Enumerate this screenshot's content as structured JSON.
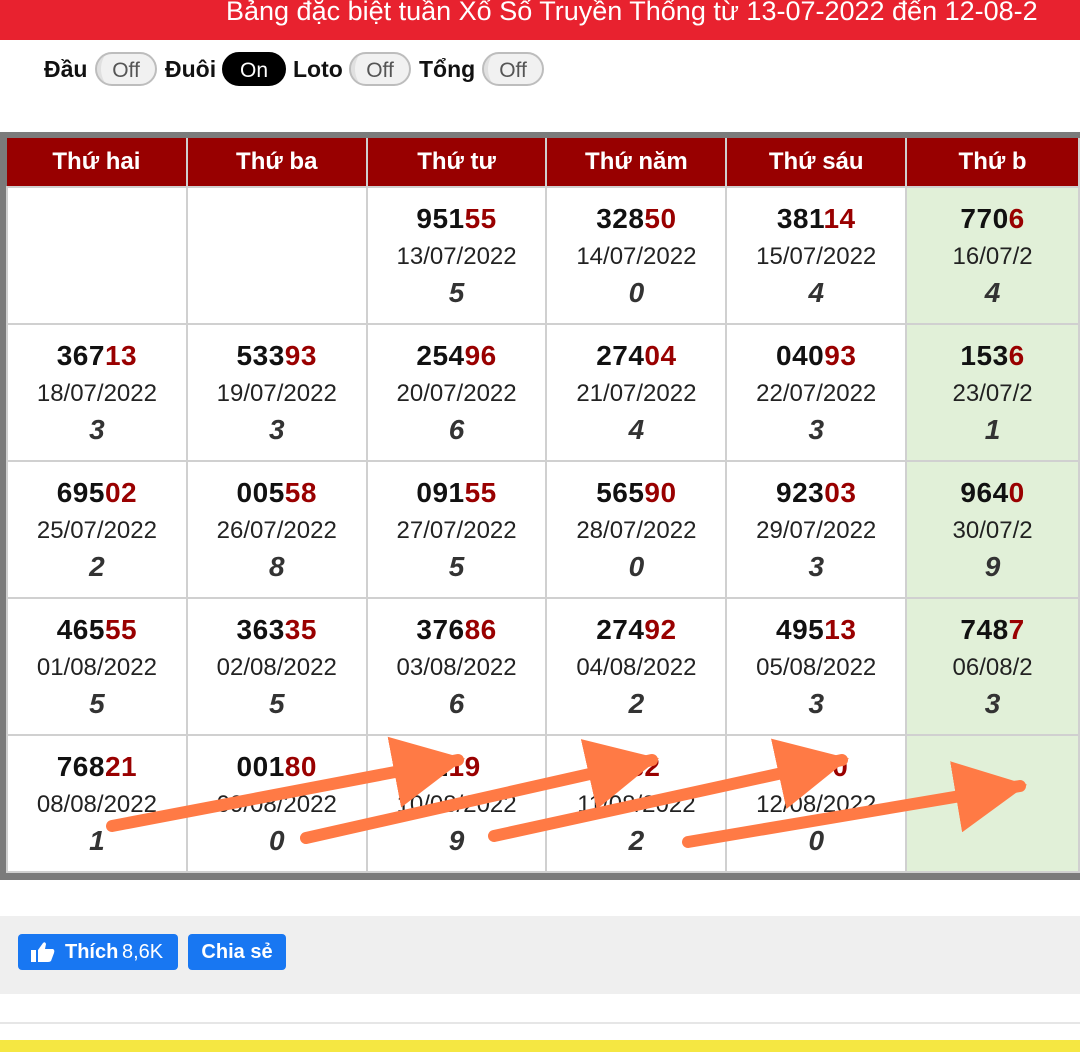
{
  "header": {
    "title": "Bảng đặc biệt tuần Xổ Số Truyền Thống từ 13-07-2022 đến 12-08-2"
  },
  "toggles": [
    {
      "label": "Đầu",
      "state": "Off"
    },
    {
      "label": "Đuôi",
      "state": "On"
    },
    {
      "label": "Loto",
      "state": "Off"
    },
    {
      "label": "Tổng",
      "state": "Off"
    }
  ],
  "table": {
    "columns": [
      "Thứ hai",
      "Thứ ba",
      "Thứ tư",
      "Thứ năm",
      "Thứ sáu",
      "Thứ b"
    ],
    "rows": [
      [
        null,
        null,
        {
          "head": "951",
          "tail": "55",
          "date": "13/07/2022",
          "total": "5"
        },
        {
          "head": "328",
          "tail": "50",
          "date": "14/07/2022",
          "total": "0"
        },
        {
          "head": "381",
          "tail": "14",
          "date": "15/07/2022",
          "total": "4"
        },
        {
          "head": "770",
          "tail": "6",
          "date": "16/07/2",
          "total": "4"
        }
      ],
      [
        {
          "head": "367",
          "tail": "13",
          "date": "18/07/2022",
          "total": "3"
        },
        {
          "head": "533",
          "tail": "93",
          "date": "19/07/2022",
          "total": "3"
        },
        {
          "head": "254",
          "tail": "96",
          "date": "20/07/2022",
          "total": "6"
        },
        {
          "head": "274",
          "tail": "04",
          "date": "21/07/2022",
          "total": "4"
        },
        {
          "head": "040",
          "tail": "93",
          "date": "22/07/2022",
          "total": "3"
        },
        {
          "head": "153",
          "tail": "6",
          "date": "23/07/2",
          "total": "1"
        }
      ],
      [
        {
          "head": "695",
          "tail": "02",
          "date": "25/07/2022",
          "total": "2"
        },
        {
          "head": "005",
          "tail": "58",
          "date": "26/07/2022",
          "total": "8"
        },
        {
          "head": "091",
          "tail": "55",
          "date": "27/07/2022",
          "total": "5"
        },
        {
          "head": "565",
          "tail": "90",
          "date": "28/07/2022",
          "total": "0"
        },
        {
          "head": "923",
          "tail": "03",
          "date": "29/07/2022",
          "total": "3"
        },
        {
          "head": "964",
          "tail": "0",
          "date": "30/07/2",
          "total": "9"
        }
      ],
      [
        {
          "head": "465",
          "tail": "55",
          "date": "01/08/2022",
          "total": "5"
        },
        {
          "head": "363",
          "tail": "35",
          "date": "02/08/2022",
          "total": "5"
        },
        {
          "head": "376",
          "tail": "86",
          "date": "03/08/2022",
          "total": "6"
        },
        {
          "head": "274",
          "tail": "92",
          "date": "04/08/2022",
          "total": "2"
        },
        {
          "head": "495",
          "tail": "13",
          "date": "05/08/2022",
          "total": "3"
        },
        {
          "head": "748",
          "tail": "7",
          "date": "06/08/2",
          "total": "3"
        }
      ],
      [
        {
          "head": "768",
          "tail": "21",
          "date": "08/08/2022",
          "total": "1"
        },
        {
          "head": "001",
          "tail": "80",
          "date": "09/08/2022",
          "total": "0"
        },
        {
          "head": "2",
          "tail": "19",
          "date": "10/08/2022",
          "total": "9"
        },
        {
          "head": "4",
          "tail": "82",
          "date": "11/08/2022",
          "total": "2"
        },
        {
          "head": "39",
          "tail": "70",
          "date": "12/08/2022",
          "total": "0"
        },
        null
      ]
    ]
  },
  "annotation": {
    "arrow_color": "#ff7a45"
  },
  "share": {
    "like_label": "Thích",
    "like_count": "8,6K",
    "share_label": "Chia sẻ"
  },
  "colors": {
    "header_red": "#e8222f",
    "column_header": "#980000",
    "tail_red": "#990000",
    "saturday_bg": "#e1f0d8",
    "fb_blue": "#1877f2"
  }
}
